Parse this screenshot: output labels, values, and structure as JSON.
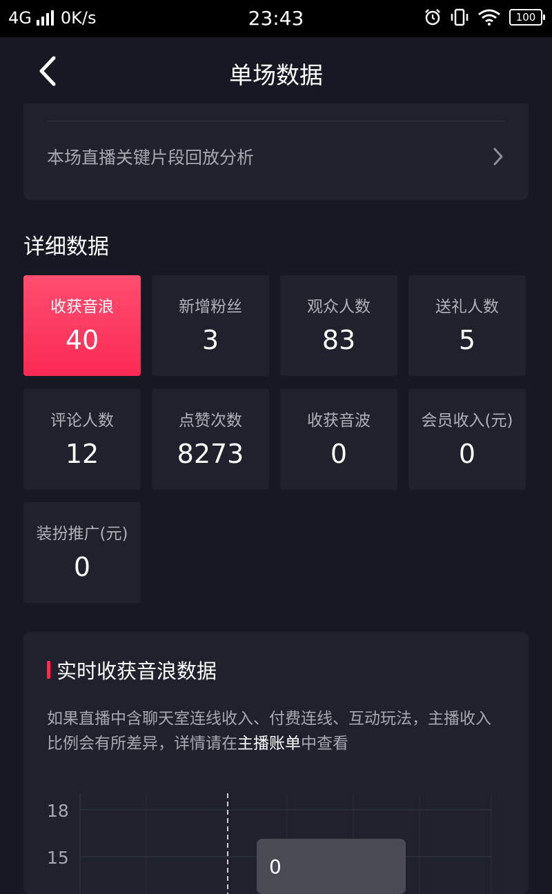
{
  "status_bar": {
    "network": "4G",
    "speed": "0K/s",
    "time": "23:43",
    "battery": "100"
  },
  "header": {
    "title": "单场数据"
  },
  "replay": {
    "label": "本场直播关键片段回放分析"
  },
  "details": {
    "title": "详细数据",
    "tiles": [
      {
        "label": "收获音浪",
        "value": "40"
      },
      {
        "label": "新增粉丝",
        "value": "3"
      },
      {
        "label": "观众人数",
        "value": "83"
      },
      {
        "label": "送礼人数",
        "value": "5"
      },
      {
        "label": "评论人数",
        "value": "12"
      },
      {
        "label": "点赞次数",
        "value": "8273"
      },
      {
        "label": "收获音波",
        "value": "0"
      },
      {
        "label": "会员收入(元)",
        "value": "0"
      },
      {
        "label": "装扮推广(元)",
        "value": "0"
      }
    ]
  },
  "realtime": {
    "title": "实时收获音浪数据",
    "desc_before": "如果直播中含聊天室连线收入、付费连线、互动玩法，主播收入比例会有所差异，详情请在",
    "desc_link": "主播账单",
    "desc_after": "中查看",
    "tooltip_value": "0"
  },
  "chart_data": {
    "type": "line",
    "y_ticks": [
      "18",
      "15"
    ],
    "grid": true
  },
  "colors": {
    "background": "#161823",
    "card": "#1f212c",
    "accent": "#fe2c55"
  }
}
